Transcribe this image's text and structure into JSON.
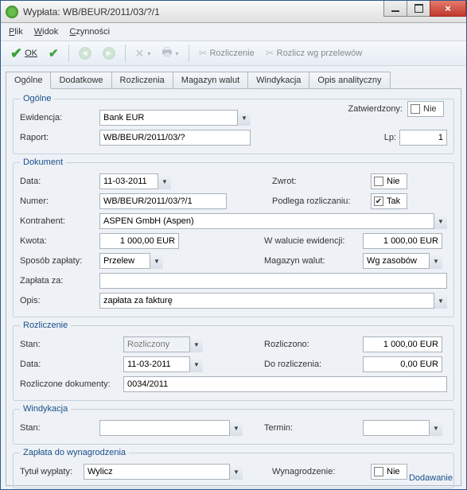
{
  "window": {
    "title": "Wypłata: WB/BEUR/2011/03/?/1"
  },
  "menu": {
    "plik": "Plik",
    "widok": "Widok",
    "czynnosci": "Czynności"
  },
  "toolbar": {
    "ok": "OK",
    "rozliczenie": "Rozliczenie",
    "rozlicz_wg": "Rozlicz wg przelewów"
  },
  "tabs": {
    "ogolne": "Ogólne",
    "dodatkowe": "Dodatkowe",
    "rozliczenia": "Rozliczenia",
    "magazyn": "Magazyn walut",
    "windykacja": "Windykacja",
    "opis": "Opis analityczny"
  },
  "ogolne": {
    "legend": "Ogólne",
    "zatwierdzony_label": "Zatwierdzony:",
    "zatwierdzony": "Nie",
    "ewidencja_label": "Ewidencja:",
    "ewidencja": "Bank EUR",
    "raport_label": "Raport:",
    "raport": "WB/BEUR/2011/03/?",
    "lp_label": "Lp:",
    "lp": "1"
  },
  "dokument": {
    "legend": "Dokument",
    "data_label": "Data:",
    "data": "11-03-2011",
    "zwrot_label": "Zwrot:",
    "zwrot": "Nie",
    "numer_label": "Numer:",
    "numer": "WB/BEUR/2011/03/?/1",
    "podlega_label": "Podlega rozliczaniu:",
    "podlega": "Tak",
    "kontrahent_label": "Kontrahent:",
    "kontrahent": "ASPEN GmbH (Aspen)",
    "kwota_label": "Kwota:",
    "kwota": "1 000,00 EUR",
    "wwalucie_label": "W walucie ewidencji:",
    "wwalucie": "1 000,00 EUR",
    "sposob_label": "Sposób zapłaty:",
    "sposob": "Przelew",
    "magwalut_label": "Magazyn walut:",
    "magwalut": "Wg zasobów",
    "zaplata_za_label": "Zapłata za:",
    "zaplata_za": "",
    "opis_label": "Opis:",
    "opis": "zapłata za fakturę"
  },
  "rozliczenie": {
    "legend": "Rozliczenie",
    "stan_label": "Stan:",
    "stan": "Rozliczony",
    "rozliczono_label": "Rozliczono:",
    "rozliczono": "1 000,00 EUR",
    "data_label": "Data:",
    "data": "11-03-2011",
    "do_label": "Do rozliczenia:",
    "do": "0,00 EUR",
    "rdok_label": "Rozliczone dokumenty:",
    "rdok": "0034/2011"
  },
  "windykacja": {
    "legend": "Windykacja",
    "stan_label": "Stan:",
    "stan": "",
    "termin_label": "Termin:",
    "termin": ""
  },
  "zaplata": {
    "legend": "Zapłata do wynagrodzenia",
    "tytul_label": "Tytuł wypłaty:",
    "tytul": "Wylicz",
    "wyn_label": "Wynagrodzenie:",
    "wyn": "Nie"
  },
  "footer": "Dodawanie"
}
